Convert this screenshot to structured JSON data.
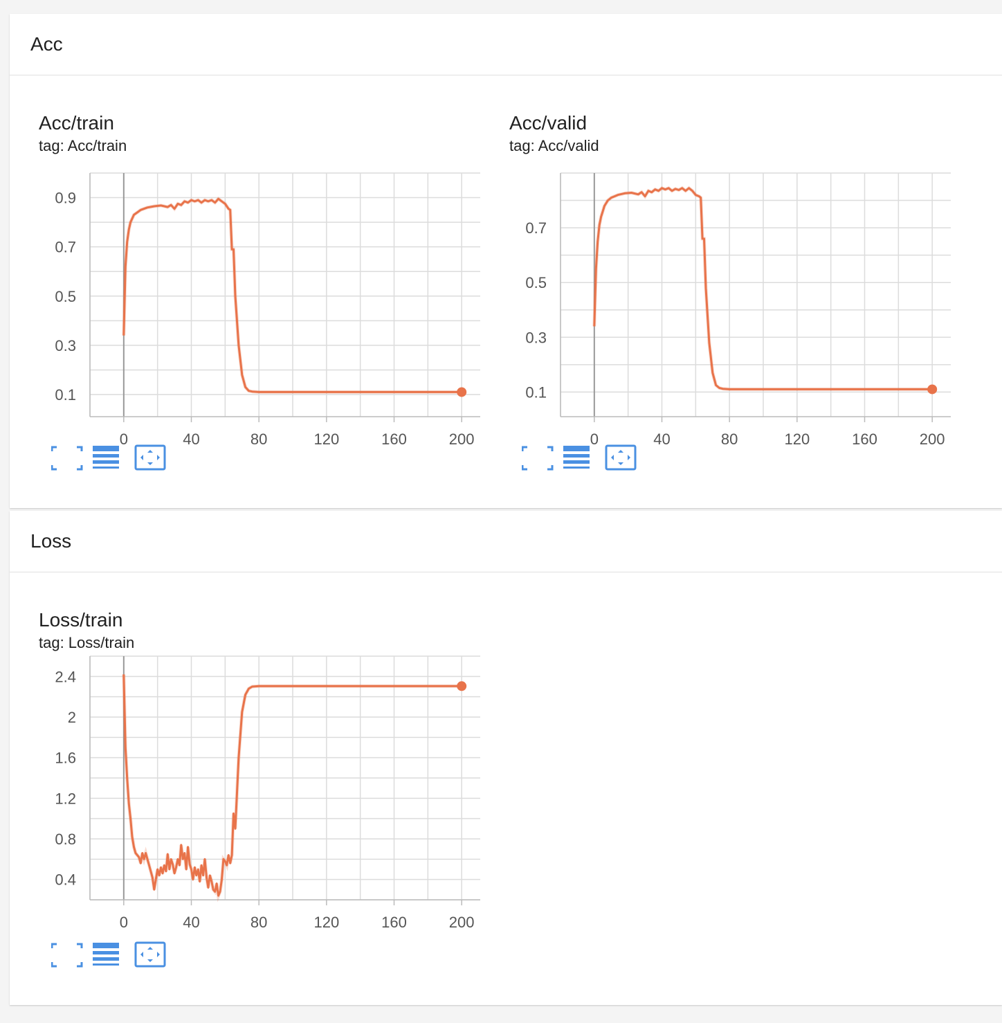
{
  "accent_color": "#e8734a",
  "icon_color": "#4a90e2",
  "sections": [
    {
      "title": "Acc",
      "cards": [
        {
          "title": "Acc/train",
          "tag": "tag: Acc/train",
          "tools": [
            "fullscreen-icon",
            "data-table-icon",
            "fit-domain-icon"
          ],
          "chart_data": {
            "type": "line",
            "title": "Acc/train",
            "xlabel": "",
            "ylabel": "",
            "xlim": [
              -20,
              220
            ],
            "ylim": [
              0.01,
              1.0
            ],
            "xticks": [
              0,
              40,
              80,
              120,
              160,
              200
            ],
            "xtick_labels": [
              "0",
              "40",
              "80",
              "120",
              "160",
              "200"
            ],
            "yticks": [
              0.1,
              0.3,
              0.5,
              0.7,
              0.9
            ],
            "ytick_labels": [
              "0.1",
              "0.3",
              "0.5",
              "0.7",
              "0.9"
            ],
            "grid": true,
            "series": [
              {
                "color": "#e8734a",
                "x": [
                  0,
                  1,
                  2,
                  3,
                  4,
                  6,
                  8,
                  10,
                  14,
                  18,
                  22,
                  26,
                  28,
                  30,
                  32,
                  34,
                  36,
                  38,
                  40,
                  42,
                  44,
                  46,
                  48,
                  50,
                  52,
                  54,
                  56,
                  58,
                  60,
                  62,
                  63,
                  64,
                  65,
                  66,
                  68,
                  70,
                  72,
                  74,
                  76,
                  80,
                  90,
                  120,
                  160,
                  200
                ],
                "values": [
                  0.34,
                  0.62,
                  0.72,
                  0.77,
                  0.8,
                  0.83,
                  0.84,
                  0.85,
                  0.86,
                  0.865,
                  0.868,
                  0.862,
                  0.87,
                  0.855,
                  0.875,
                  0.87,
                  0.885,
                  0.88,
                  0.89,
                  0.885,
                  0.89,
                  0.88,
                  0.89,
                  0.885,
                  0.89,
                  0.88,
                  0.895,
                  0.885,
                  0.875,
                  0.855,
                  0.85,
                  0.69,
                  0.69,
                  0.5,
                  0.3,
                  0.18,
                  0.13,
                  0.115,
                  0.112,
                  0.11,
                  0.11,
                  0.11,
                  0.11,
                  0.11
                ]
              }
            ]
          }
        },
        {
          "title": "Acc/valid",
          "tag": "tag: Acc/valid",
          "tools": [
            "fullscreen-icon",
            "data-table-icon",
            "fit-domain-icon"
          ],
          "chart_data": {
            "type": "line",
            "title": "Acc/valid",
            "xlabel": "",
            "ylabel": "",
            "xlim": [
              -20,
              220
            ],
            "ylim": [
              0.01,
              0.9
            ],
            "xticks": [
              0,
              40,
              80,
              120,
              160,
              200
            ],
            "xtick_labels": [
              "0",
              "40",
              "80",
              "120",
              "160",
              "200"
            ],
            "yticks": [
              0.1,
              0.3,
              0.5,
              0.7
            ],
            "ytick_labels": [
              "0.1",
              "0.3",
              "0.5",
              "0.7"
            ],
            "grid": true,
            "series": [
              {
                "color": "#e8734a",
                "x": [
                  0,
                  1,
                  2,
                  3,
                  4,
                  6,
                  8,
                  10,
                  14,
                  18,
                  22,
                  26,
                  28,
                  30,
                  32,
                  34,
                  36,
                  38,
                  40,
                  42,
                  44,
                  46,
                  48,
                  50,
                  52,
                  54,
                  56,
                  58,
                  60,
                  62,
                  63,
                  64,
                  65,
                  66,
                  68,
                  70,
                  72,
                  74,
                  76,
                  80,
                  90,
                  120,
                  160,
                  200
                ],
                "values": [
                  0.34,
                  0.55,
                  0.65,
                  0.71,
                  0.74,
                  0.78,
                  0.8,
                  0.81,
                  0.82,
                  0.826,
                  0.828,
                  0.822,
                  0.83,
                  0.815,
                  0.835,
                  0.83,
                  0.84,
                  0.835,
                  0.845,
                  0.84,
                  0.845,
                  0.835,
                  0.842,
                  0.838,
                  0.845,
                  0.835,
                  0.845,
                  0.835,
                  0.82,
                  0.815,
                  0.81,
                  0.66,
                  0.66,
                  0.48,
                  0.28,
                  0.17,
                  0.125,
                  0.115,
                  0.112,
                  0.11,
                  0.11,
                  0.11,
                  0.11,
                  0.11
                ]
              }
            ]
          }
        }
      ]
    },
    {
      "title": "Loss",
      "cards": [
        {
          "title": "Loss/train",
          "tag": "tag: Loss/train",
          "tools": [
            "fullscreen-icon",
            "data-table-icon",
            "fit-domain-icon"
          ],
          "chart_data": {
            "type": "line",
            "title": "Loss/train",
            "xlabel": "",
            "ylabel": "",
            "xlim": [
              -20,
              220
            ],
            "ylim": [
              0.2,
              2.6
            ],
            "xticks": [
              0,
              40,
              80,
              120,
              160,
              200
            ],
            "xtick_labels": [
              "0",
              "40",
              "80",
              "120",
              "160",
              "200"
            ],
            "yticks": [
              0.4,
              0.8,
              1.2,
              1.6,
              2.0,
              2.4
            ],
            "ytick_labels": [
              "0.4",
              "0.8",
              "1.2",
              "1.6",
              "2",
              "2.4"
            ],
            "grid": true,
            "series": [
              {
                "color": "#e8734a",
                "x": [
                  0,
                  1,
                  2,
                  3,
                  4,
                  5,
                  6,
                  7,
                  8,
                  9,
                  10,
                  11,
                  12,
                  13,
                  14,
                  15,
                  16,
                  17,
                  18,
                  19,
                  20,
                  21,
                  22,
                  23,
                  24,
                  25,
                  26,
                  27,
                  28,
                  29,
                  30,
                  31,
                  32,
                  33,
                  34,
                  35,
                  36,
                  37,
                  38,
                  39,
                  40,
                  41,
                  42,
                  43,
                  44,
                  45,
                  46,
                  47,
                  48,
                  49,
                  50,
                  51,
                  52,
                  53,
                  54,
                  55,
                  56,
                  57,
                  58,
                  59,
                  60,
                  61,
                  62,
                  63,
                  64,
                  65,
                  66,
                  68,
                  70,
                  72,
                  74,
                  76,
                  80,
                  90,
                  120,
                  160,
                  200
                ],
                "values": [
                  2.42,
                  1.7,
                  1.4,
                  1.15,
                  1.0,
                  0.82,
                  0.72,
                  0.66,
                  0.64,
                  0.62,
                  0.56,
                  0.66,
                  0.6,
                  0.66,
                  0.6,
                  0.54,
                  0.48,
                  0.42,
                  0.3,
                  0.4,
                  0.5,
                  0.44,
                  0.52,
                  0.46,
                  0.54,
                  0.48,
                  0.65,
                  0.5,
                  0.6,
                  0.55,
                  0.46,
                  0.52,
                  0.6,
                  0.54,
                  0.74,
                  0.6,
                  0.66,
                  0.5,
                  0.72,
                  0.55,
                  0.5,
                  0.4,
                  0.52,
                  0.44,
                  0.5,
                  0.38,
                  0.54,
                  0.44,
                  0.6,
                  0.42,
                  0.32,
                  0.44,
                  0.38,
                  0.3,
                  0.28,
                  0.36,
                  0.24,
                  0.28,
                  0.4,
                  0.6,
                  0.58,
                  0.54,
                  0.64,
                  0.56,
                  0.64,
                  1.05,
                  0.9,
                  1.6,
                  2.05,
                  2.22,
                  2.28,
                  2.3,
                  2.305,
                  2.305,
                  2.305,
                  2.305,
                  2.305
                ]
              }
            ]
          }
        }
      ]
    }
  ]
}
